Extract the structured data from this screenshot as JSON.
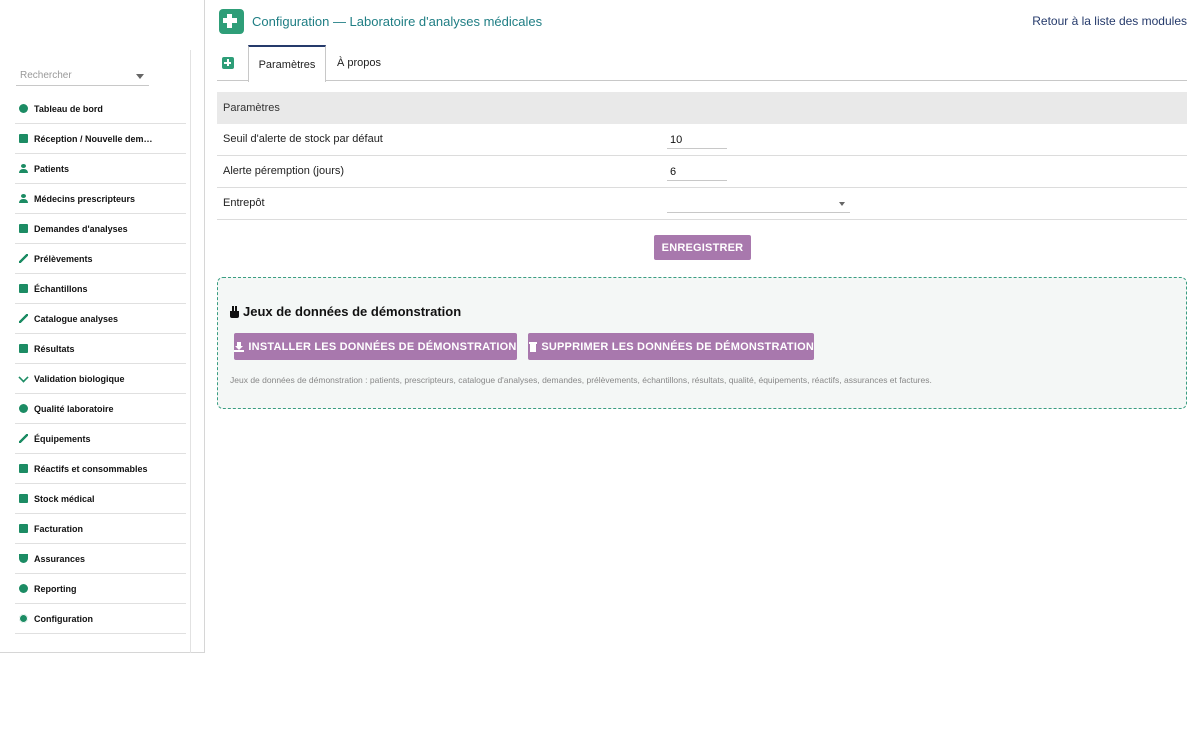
{
  "header": {
    "title": "Configuration — Laboratoire d'analyses médicales",
    "back_link": "Retour à la liste des modules"
  },
  "sidebar": {
    "search_placeholder": "Rechercher",
    "items": [
      {
        "label": "Tableau de bord",
        "icon": "dashboard-icon"
      },
      {
        "label": "Réception / Nouvelle dem…",
        "icon": "clipboard-icon"
      },
      {
        "label": "Patients",
        "icon": "user-icon"
      },
      {
        "label": "Médecins prescripteurs",
        "icon": "doctor-icon"
      },
      {
        "label": "Demandes d'analyses",
        "icon": "file-icon"
      },
      {
        "label": "Prélèvements",
        "icon": "syringe-icon"
      },
      {
        "label": "Échantillons",
        "icon": "flask-icon"
      },
      {
        "label": "Catalogue analyses",
        "icon": "pen-icon"
      },
      {
        "label": "Résultats",
        "icon": "clipboard-check-icon"
      },
      {
        "label": "Validation biologique",
        "icon": "check-double-icon"
      },
      {
        "label": "Qualité laboratoire",
        "icon": "circle-icon"
      },
      {
        "label": "Équipements",
        "icon": "microscope-icon"
      },
      {
        "label": "Réactifs et consommables",
        "icon": "vial-icon"
      },
      {
        "label": "Stock médical",
        "icon": "boxes-icon"
      },
      {
        "label": "Facturation",
        "icon": "invoice-icon"
      },
      {
        "label": "Assurances",
        "icon": "shield-icon"
      },
      {
        "label": "Reporting",
        "icon": "chart-pie-icon"
      },
      {
        "label": "Configuration",
        "icon": "gear-icon"
      }
    ]
  },
  "tabs": {
    "params": "Paramètres",
    "about": "À propos"
  },
  "params": {
    "header": "Paramètres",
    "rows": [
      {
        "label": "Seuil d'alerte de stock par défaut",
        "value": "10"
      },
      {
        "label": "Alerte péremption (jours)",
        "value": "6"
      },
      {
        "label": "Entrepôt",
        "value": ""
      }
    ]
  },
  "actions": {
    "save": "ENREGISTRER"
  },
  "demo": {
    "title": "Jeux de données de démonstration",
    "install": "INSTALLER LES DONNÉES DE DÉMONSTRATION",
    "delete": "SUPPRIMER LES DONNÉES DE DÉMONSTRATION",
    "description": "Jeux de données de démonstration : patients, prescripteurs, catalogue d'analyses, demandes, prélèvements, échantillons, résultats, qualité, équipements, réactifs, assurances et factures."
  },
  "colors": {
    "accent_green": "#2e9e78",
    "button_purple": "#a878ad",
    "title_teal": "#1f7e84",
    "link_navy": "#253a6b"
  }
}
